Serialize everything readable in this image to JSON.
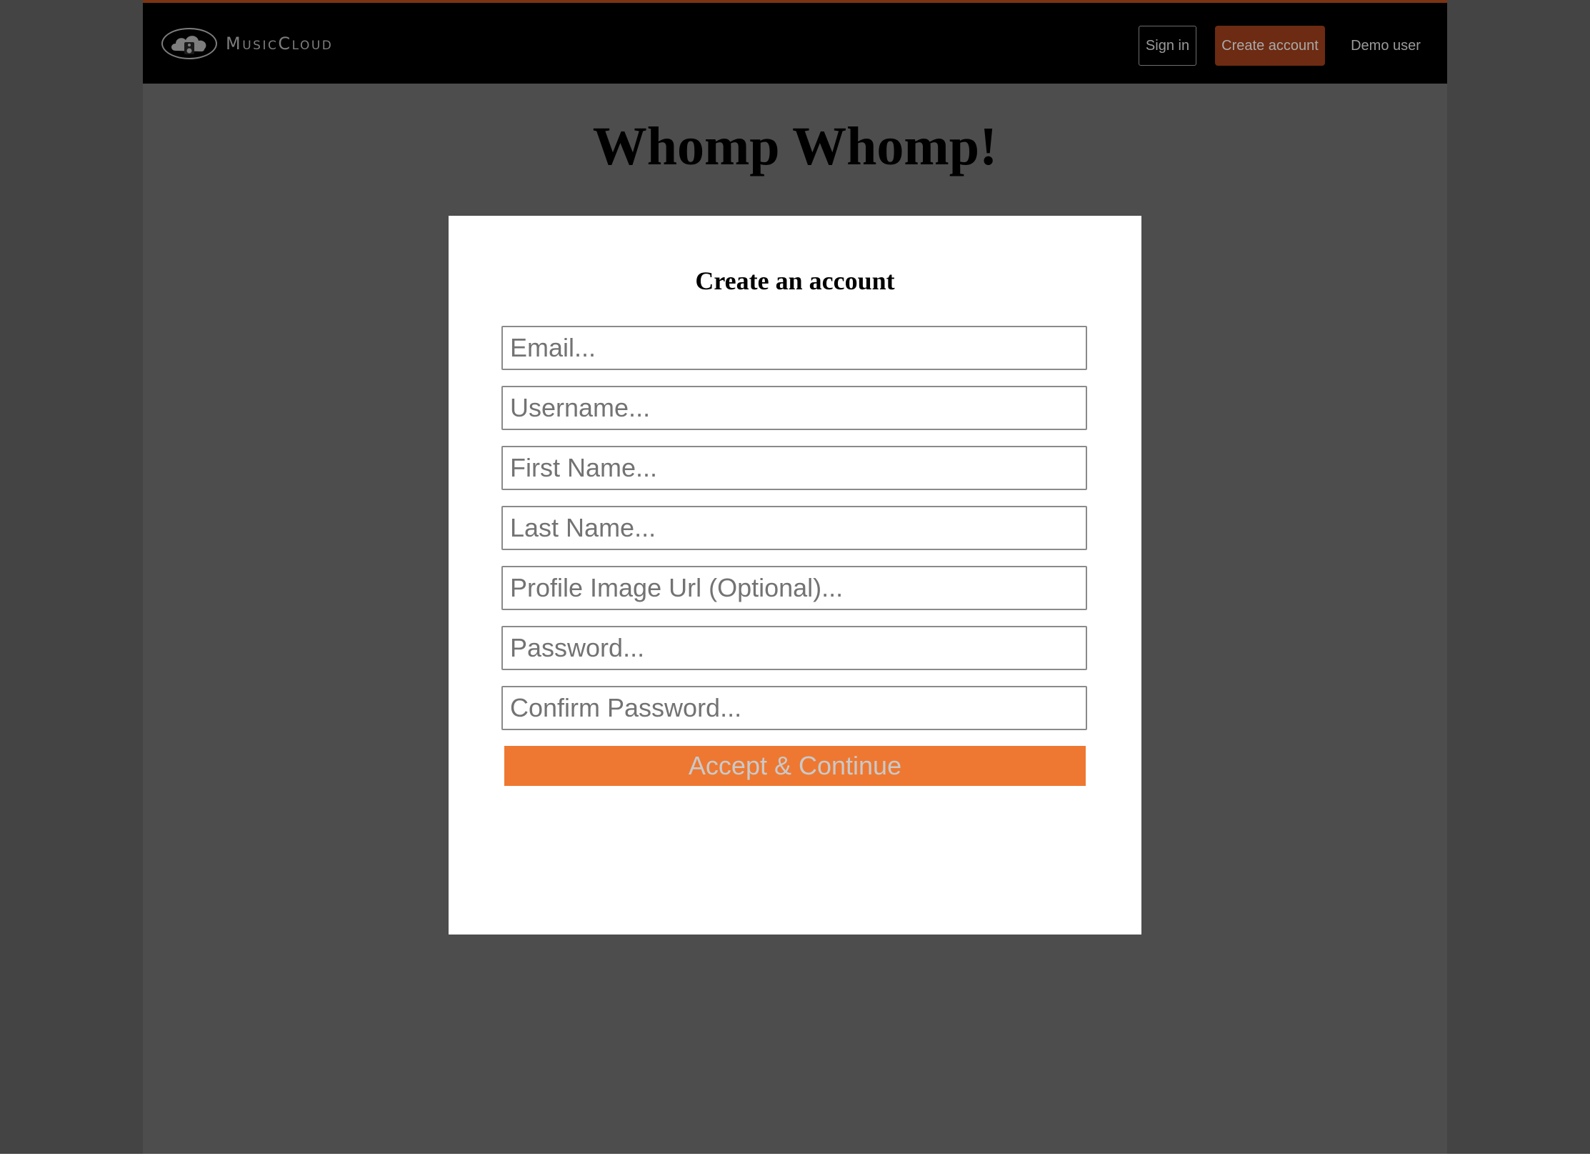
{
  "nav": {
    "logo_text": "MusicCloud",
    "logo_icon": "cloud-speaker-icon",
    "signin_label": "Sign in",
    "create_account_label": "Create account",
    "demo_user_label": "Demo user"
  },
  "page": {
    "title": "Whomp Whomp!"
  },
  "form": {
    "title": "Create an account",
    "email_placeholder": "Email...",
    "username_placeholder": "Username...",
    "first_name_placeholder": "First Name...",
    "last_name_placeholder": "Last Name...",
    "profile_image_placeholder": "Profile Image Url (Optional)...",
    "password_placeholder": "Password...",
    "confirm_password_placeholder": "Confirm Password...",
    "submit_label": "Accept & Continue"
  },
  "colors": {
    "accent": "#ee7831",
    "navbar_bg": "#000000",
    "create_button_bg": "#6c2b12",
    "page_bg": "#4d4d4d"
  }
}
